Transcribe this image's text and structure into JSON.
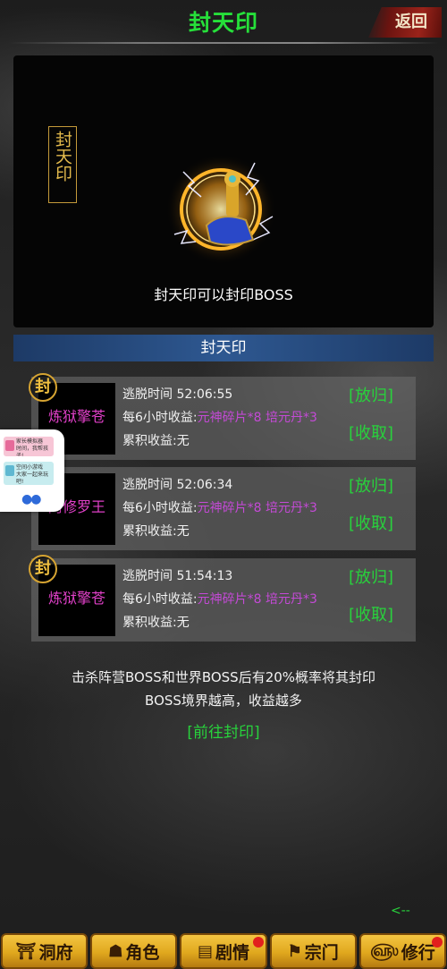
{
  "header": {
    "title": "封天印",
    "back_label": "返回"
  },
  "showcase": {
    "seal_label": "封天印",
    "caption": "封天印可以封印BOSS"
  },
  "section": {
    "title": "封天印"
  },
  "cards": [
    {
      "badge": "封",
      "boss_name": "炼狱擎苍",
      "escape_text": "逃脱时间 52:06:55",
      "income_prefix": "每6小时收益:",
      "income_rewards": "元神碎片*8 培元丹*3",
      "accum_text": "累积收益:无",
      "release_label": "[放归]",
      "collect_label": "[收取]"
    },
    {
      "badge": "",
      "boss_name": "阿修罗王",
      "escape_text": "逃脱时间 52:06:34",
      "income_prefix": "每6小时收益:",
      "income_rewards": "元神碎片*8 培元丹*3",
      "accum_text": "累积收益:无",
      "release_label": "[放归]",
      "collect_label": "[收取]"
    },
    {
      "badge": "封",
      "boss_name": "炼狱擎苍",
      "escape_text": "逃脱时间 51:54:13",
      "income_prefix": "每6小时收益:",
      "income_rewards": "元神碎片*8 培元丹*3",
      "accum_text": "累积收益:无",
      "release_label": "[放归]",
      "collect_label": "[收取]"
    }
  ],
  "hint": {
    "line1": "击杀阵营BOSS和世界BOSS后有20%概率将其封印",
    "line2": "BOSS境界越高，收益越多"
  },
  "goto_seal_label": "[前往封印]",
  "back_arrow": "<--",
  "float_widget": {
    "ad1_title": "家长模拟器",
    "ad1_sub": "时间，我帮孩子!",
    "ad2_title": "空间小游戏",
    "ad2_sub": "大家一起来玩吧!"
  },
  "bottom_nav": [
    {
      "label": "洞府",
      "icon": "cave-icon",
      "badge": false
    },
    {
      "label": "角色",
      "icon": "character-icon",
      "badge": false
    },
    {
      "label": "剧情",
      "icon": "story-icon",
      "badge": true
    },
    {
      "label": "宗门",
      "icon": "sect-icon",
      "badge": false
    },
    {
      "label": "修行",
      "icon": "cultivate-icon",
      "badge": true
    }
  ],
  "colors": {
    "title_green": "#26e03a",
    "action_green": "#28d23c",
    "boss_magenta": "#e040c8",
    "reward_purple": "#c44ad6",
    "section_blue": "#2e5891",
    "nav_gold": "#e0a81e"
  }
}
